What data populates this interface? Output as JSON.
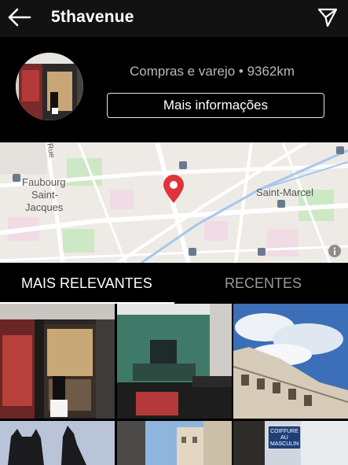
{
  "topbar": {
    "title": "5thavenue",
    "back_icon": "arrow-left-icon",
    "send_icon": "paper-plane-icon"
  },
  "header": {
    "category_distance": "Compras e varejo • 9362km",
    "more_info_label": "Mais informações"
  },
  "map": {
    "labels": {
      "faubourg": "Faubourg",
      "saint": "Saint-",
      "jacques": "Jacques",
      "saint_marcel": "Saint-Marcel",
      "rue": "Rue"
    },
    "pin_color": "#e0323a",
    "info_icon": "info-icon"
  },
  "tabs": {
    "relevant": "MAIS RELEVANTES",
    "recent": "RECENTES"
  },
  "grid": {
    "posts": [
      {
        "subject": "storefront"
      },
      {
        "subject": "green-building"
      },
      {
        "subject": "sky-buildings"
      },
      {
        "subject": "cats"
      },
      {
        "subject": "street"
      },
      {
        "subject": "street-sign"
      }
    ],
    "sign_text": "COIFFURE AU MASCULIN"
  },
  "colors": {
    "background": "#000000",
    "topbar": "#121212",
    "muted_text": "#b9b9b9",
    "inactive_tab": "#9a9a9a"
  }
}
